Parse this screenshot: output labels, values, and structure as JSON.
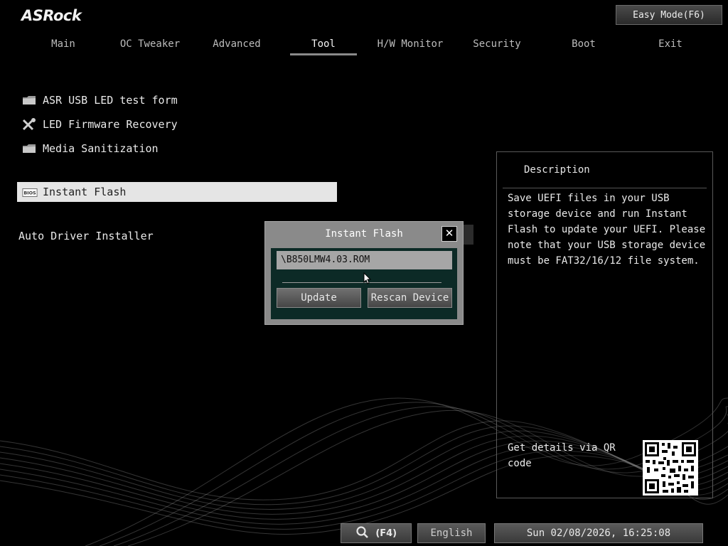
{
  "brand": {
    "logo_text": "ASRock"
  },
  "header": {
    "easy_mode_label": "Easy Mode(F6)"
  },
  "nav": {
    "tabs": [
      {
        "label": "Main"
      },
      {
        "label": "OC Tweaker"
      },
      {
        "label": "Advanced"
      },
      {
        "label": "Tool",
        "active": true
      },
      {
        "label": "H/W Monitor"
      },
      {
        "label": "Security"
      },
      {
        "label": "Boot"
      },
      {
        "label": "Exit"
      }
    ]
  },
  "menu": {
    "items": [
      {
        "label": "ASR USB LED test form",
        "icon": "folder-icon"
      },
      {
        "label": "LED Firmware Recovery",
        "icon": "tools-icon"
      },
      {
        "label": "Media Sanitization",
        "icon": "folder-icon"
      },
      {
        "label": "Instant Flash",
        "icon": "bios-chip-icon",
        "selected": true
      },
      {
        "label": "Auto Driver Installer",
        "icon": ""
      }
    ]
  },
  "description": {
    "title": "Description",
    "text": "Save UEFI files in your USB storage device and run Instant Flash to update your UEFI. Please note that your USB storage device must be FAT32/16/12 file system.",
    "qr_text": "Get details via QR code"
  },
  "dialog": {
    "title": "Instant Flash",
    "file_value": "\\B850LMW4.03.ROM",
    "update_label": "Update",
    "rescan_label": "Rescan Device",
    "close_icon": "close-icon"
  },
  "bottom": {
    "search_key": "(F4)",
    "language": "English",
    "datetime": "Sun 02/08/2026, 16:25:08"
  },
  "colors": {
    "background": "#000000",
    "selected_bg": "#e5e5e5",
    "dialog_frame": "#8a8a8a",
    "dialog_body": "#0c2a26"
  }
}
